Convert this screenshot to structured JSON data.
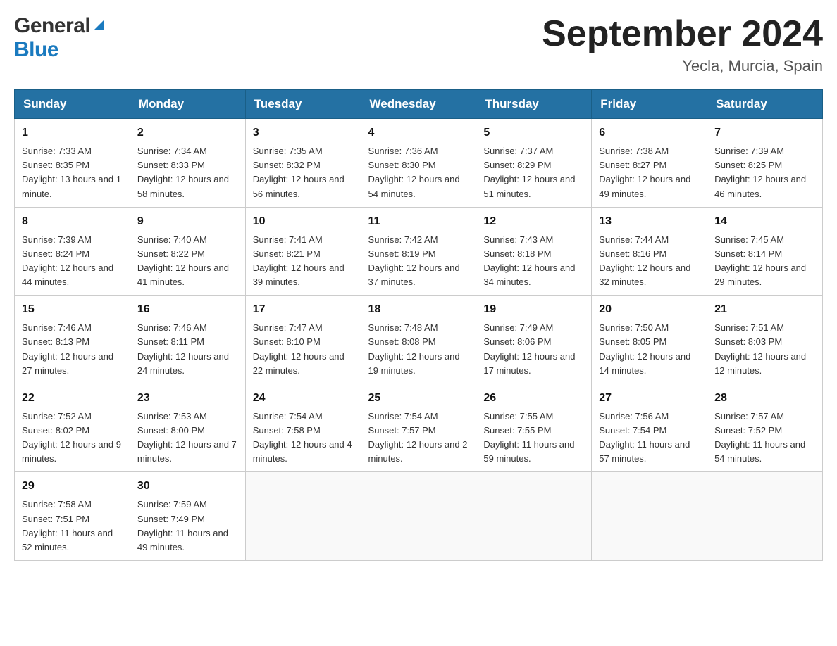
{
  "header": {
    "logo_general": "General",
    "logo_blue": "Blue",
    "month_title": "September 2024",
    "location": "Yecla, Murcia, Spain"
  },
  "days_of_week": [
    "Sunday",
    "Monday",
    "Tuesday",
    "Wednesday",
    "Thursday",
    "Friday",
    "Saturday"
  ],
  "weeks": [
    [
      {
        "day": "1",
        "sunrise": "7:33 AM",
        "sunset": "8:35 PM",
        "daylight": "13 hours and 1 minute."
      },
      {
        "day": "2",
        "sunrise": "7:34 AM",
        "sunset": "8:33 PM",
        "daylight": "12 hours and 58 minutes."
      },
      {
        "day": "3",
        "sunrise": "7:35 AM",
        "sunset": "8:32 PM",
        "daylight": "12 hours and 56 minutes."
      },
      {
        "day": "4",
        "sunrise": "7:36 AM",
        "sunset": "8:30 PM",
        "daylight": "12 hours and 54 minutes."
      },
      {
        "day": "5",
        "sunrise": "7:37 AM",
        "sunset": "8:29 PM",
        "daylight": "12 hours and 51 minutes."
      },
      {
        "day": "6",
        "sunrise": "7:38 AM",
        "sunset": "8:27 PM",
        "daylight": "12 hours and 49 minutes."
      },
      {
        "day": "7",
        "sunrise": "7:39 AM",
        "sunset": "8:25 PM",
        "daylight": "12 hours and 46 minutes."
      }
    ],
    [
      {
        "day": "8",
        "sunrise": "7:39 AM",
        "sunset": "8:24 PM",
        "daylight": "12 hours and 44 minutes."
      },
      {
        "day": "9",
        "sunrise": "7:40 AM",
        "sunset": "8:22 PM",
        "daylight": "12 hours and 41 minutes."
      },
      {
        "day": "10",
        "sunrise": "7:41 AM",
        "sunset": "8:21 PM",
        "daylight": "12 hours and 39 minutes."
      },
      {
        "day": "11",
        "sunrise": "7:42 AM",
        "sunset": "8:19 PM",
        "daylight": "12 hours and 37 minutes."
      },
      {
        "day": "12",
        "sunrise": "7:43 AM",
        "sunset": "8:18 PM",
        "daylight": "12 hours and 34 minutes."
      },
      {
        "day": "13",
        "sunrise": "7:44 AM",
        "sunset": "8:16 PM",
        "daylight": "12 hours and 32 minutes."
      },
      {
        "day": "14",
        "sunrise": "7:45 AM",
        "sunset": "8:14 PM",
        "daylight": "12 hours and 29 minutes."
      }
    ],
    [
      {
        "day": "15",
        "sunrise": "7:46 AM",
        "sunset": "8:13 PM",
        "daylight": "12 hours and 27 minutes."
      },
      {
        "day": "16",
        "sunrise": "7:46 AM",
        "sunset": "8:11 PM",
        "daylight": "12 hours and 24 minutes."
      },
      {
        "day": "17",
        "sunrise": "7:47 AM",
        "sunset": "8:10 PM",
        "daylight": "12 hours and 22 minutes."
      },
      {
        "day": "18",
        "sunrise": "7:48 AM",
        "sunset": "8:08 PM",
        "daylight": "12 hours and 19 minutes."
      },
      {
        "day": "19",
        "sunrise": "7:49 AM",
        "sunset": "8:06 PM",
        "daylight": "12 hours and 17 minutes."
      },
      {
        "day": "20",
        "sunrise": "7:50 AM",
        "sunset": "8:05 PM",
        "daylight": "12 hours and 14 minutes."
      },
      {
        "day": "21",
        "sunrise": "7:51 AM",
        "sunset": "8:03 PM",
        "daylight": "12 hours and 12 minutes."
      }
    ],
    [
      {
        "day": "22",
        "sunrise": "7:52 AM",
        "sunset": "8:02 PM",
        "daylight": "12 hours and 9 minutes."
      },
      {
        "day": "23",
        "sunrise": "7:53 AM",
        "sunset": "8:00 PM",
        "daylight": "12 hours and 7 minutes."
      },
      {
        "day": "24",
        "sunrise": "7:54 AM",
        "sunset": "7:58 PM",
        "daylight": "12 hours and 4 minutes."
      },
      {
        "day": "25",
        "sunrise": "7:54 AM",
        "sunset": "7:57 PM",
        "daylight": "12 hours and 2 minutes."
      },
      {
        "day": "26",
        "sunrise": "7:55 AM",
        "sunset": "7:55 PM",
        "daylight": "11 hours and 59 minutes."
      },
      {
        "day": "27",
        "sunrise": "7:56 AM",
        "sunset": "7:54 PM",
        "daylight": "11 hours and 57 minutes."
      },
      {
        "day": "28",
        "sunrise": "7:57 AM",
        "sunset": "7:52 PM",
        "daylight": "11 hours and 54 minutes."
      }
    ],
    [
      {
        "day": "29",
        "sunrise": "7:58 AM",
        "sunset": "7:51 PM",
        "daylight": "11 hours and 52 minutes."
      },
      {
        "day": "30",
        "sunrise": "7:59 AM",
        "sunset": "7:49 PM",
        "daylight": "11 hours and 49 minutes."
      },
      null,
      null,
      null,
      null,
      null
    ]
  ],
  "labels": {
    "sunrise": "Sunrise:",
    "sunset": "Sunset:",
    "daylight": "Daylight:"
  }
}
